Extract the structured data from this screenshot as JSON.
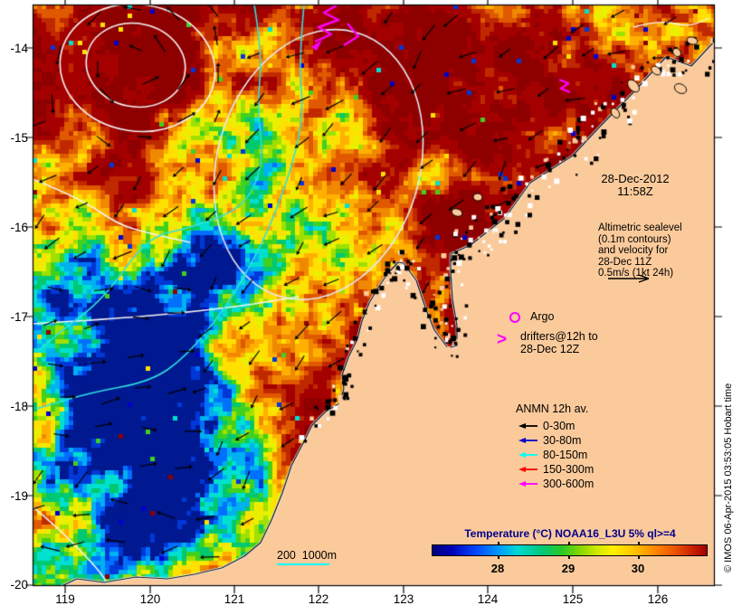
{
  "figure": {
    "background": "#FFFFFF",
    "land_color": "#FBCA9B",
    "ocean_base_color": "#A80000"
  },
  "timestamp": {
    "line1": "28-Dec-2012",
    "line2": "11:58Z"
  },
  "altimetric_note": {
    "lines": [
      "Altimetric sealevel",
      "(0.1m contours)",
      "and velocity for",
      "28-Dec 11Z",
      "0.5m/s (1kt 24h)"
    ]
  },
  "argo": {
    "label": "Argo",
    "marker_color": "#FF00FF"
  },
  "drifters": {
    "glyph": ">",
    "line1": "drifters@12h to",
    "line2": "28-Dec 12Z",
    "color": "#FF00FF"
  },
  "anmn_legend": {
    "title": "ANMN 12h av.",
    "items": [
      {
        "label": "0-30m",
        "color": "#000000"
      },
      {
        "label": "30-80m",
        "color": "#0000CC"
      },
      {
        "label": "80-150m",
        "color": "#00FFFF"
      },
      {
        "label": "150-300m",
        "color": "#FF0000"
      },
      {
        "label": "300-600m",
        "color": "#FF00FF"
      }
    ]
  },
  "bathymetry_key": {
    "label": "200  1000m",
    "line_color": "#00FFFF"
  },
  "colorbar": {
    "title": "Temperature (°C) NOAA16_L3U 5% ql>=4",
    "title_color": "#00008B",
    "tick_labels": [
      "28",
      "29",
      "30"
    ]
  },
  "axes": {
    "lon_ticks": [
      "119",
      "120",
      "121",
      "122",
      "123",
      "124",
      "125",
      "126"
    ],
    "lat_ticks": [
      "-14",
      "-15",
      "-16",
      "-17",
      "-18",
      "-19",
      "-20"
    ]
  },
  "credit": "© IMOS 06-Apr-2015 03:53:05 Hobart time"
}
